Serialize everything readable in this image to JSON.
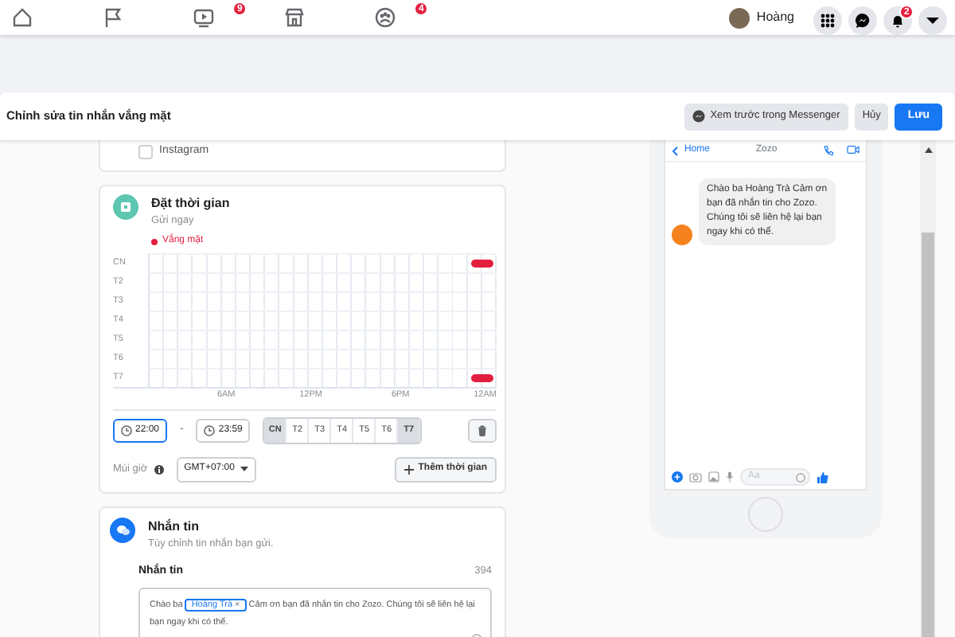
{
  "top_nav": {
    "tabs": [
      {
        "kind": "home"
      },
      {
        "kind": "flag"
      },
      {
        "kind": "video",
        "badge": "9"
      },
      {
        "kind": "store"
      },
      {
        "kind": "groups",
        "badge": "4"
      }
    ],
    "profile": {
      "name": "Hoàng"
    },
    "actions": [
      {
        "kind": "grid"
      },
      {
        "kind": "messenger"
      },
      {
        "kind": "bell",
        "badge": "2"
      },
      {
        "kind": "caret"
      }
    ]
  },
  "toolbar": {
    "title": "Chỉnh sửa tin nhắn vắng mặt",
    "preview_button": "Xem trước trong Messenger",
    "cancel_button": "Hủy",
    "save_button": "Lưu"
  },
  "platforms": [
    {
      "label": "Instagram",
      "checked": false
    }
  ],
  "schedule": {
    "title": "Đặt thời gian",
    "subtitle": "Gửi ngay",
    "legend": "Vắng mặt",
    "rows": [
      {
        "label": "CN",
        "absent": true
      },
      {
        "label": "T2",
        "absent": false
      },
      {
        "label": "T3",
        "absent": false
      },
      {
        "label": "T4",
        "absent": false
      },
      {
        "label": "T5",
        "absent": false
      },
      {
        "label": "T6",
        "absent": false
      },
      {
        "label": "T7",
        "absent": true
      }
    ],
    "x_labels": [
      "6AM",
      "12PM",
      "6PM",
      "12AM"
    ],
    "start_time": "22:00",
    "separator": "-",
    "end_time": "23:59",
    "days": [
      {
        "label": "CN",
        "selected": true
      },
      {
        "label": "T2",
        "selected": false
      },
      {
        "label": "T3",
        "selected": false
      },
      {
        "label": "T4",
        "selected": false
      },
      {
        "label": "T5",
        "selected": false
      },
      {
        "label": "T6",
        "selected": false
      },
      {
        "label": "T7",
        "selected": true
      }
    ],
    "timezone_label": "Múi giờ",
    "timezone": "GMT+07:00",
    "add_button": "Thêm thời gian"
  },
  "message": {
    "title": "Nhắn tin",
    "subtitle": "Tùy chỉnh tin nhắn bạn gửi.",
    "field_label": "Nhắn tin",
    "counter": "394",
    "parts": [
      {
        "kind": "text",
        "text": "Chào ba"
      },
      {
        "kind": "token",
        "text": "Hoàng Trà",
        "remove": "×"
      },
      {
        "kind": "text",
        "text": "Cảm ơn bạn đã nhắn tin cho Zozo. Chúng tôi sẽ liên hệ lại bạn ngay khi có thể."
      }
    ]
  },
  "preview": {
    "back": "Home",
    "contact": "Zozo",
    "bubble": "Chào ba Hoàng Trà  Cảm ơn bạn đã nhắn tin cho Zozo. Chúng tôi sẽ liên hệ lại bạn ngay khi có thể.",
    "composer_placeholder": "Aa"
  }
}
